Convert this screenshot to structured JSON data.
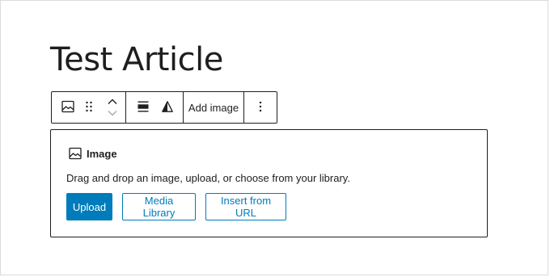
{
  "post": {
    "title": "Test Article"
  },
  "toolbar": {
    "block_type_icon": "image-icon",
    "drag_icon": "drag-handle-icon",
    "move_up_icon": "chevron-up-icon",
    "move_down_icon": "chevron-down-icon",
    "align_icon": "align-wide-icon",
    "filter_icon": "duotone-filter-icon",
    "add_image_label": "Add image",
    "more_icon": "more-vertical-icon"
  },
  "placeholder": {
    "icon": "image-icon",
    "label": "Image",
    "instructions": "Drag and drop an image, upload, or choose from your library.",
    "upload_label": "Upload",
    "media_library_label": "Media Library",
    "insert_url_label": "Insert from URL"
  },
  "colors": {
    "accent": "#007cba",
    "text": "#1e1e1e",
    "frame": "#dcdcde"
  }
}
